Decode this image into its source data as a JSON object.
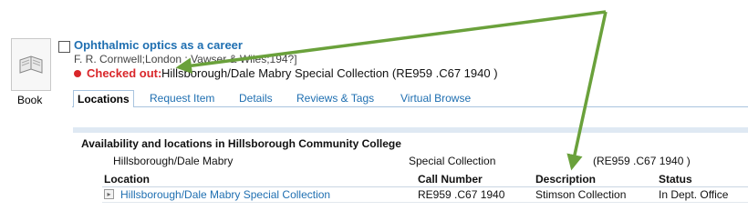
{
  "record": {
    "type_label": "Book",
    "title": "Ophthalmic optics as a career",
    "author_line": "F. R. Cornwell;London : Vawser & Wiles;194?]",
    "status_label": "Checked out:",
    "status_text": "Hillsborough/Dale Mabry Special Collection (RE959 .C67 1940 )"
  },
  "tabs": [
    {
      "label": "Locations",
      "active": true
    },
    {
      "label": "Request Item"
    },
    {
      "label": "Details"
    },
    {
      "label": "Reviews & Tags"
    },
    {
      "label": "Virtual Browse"
    }
  ],
  "availability": {
    "heading": "Availability and locations in Hillsborough Community College",
    "summary": {
      "location": "Hillsborough/Dale Mabry",
      "collection": "Special Collection",
      "call_number": "(RE959 .C67 1940 )"
    },
    "columns": [
      "Location",
      "Call Number",
      "Description",
      "Status"
    ],
    "rows": [
      {
        "location": "Hillsborough/Dale Mabry Special Collection",
        "call_number": "RE959 .C67 1940",
        "description": "Stimson Collection",
        "status": "In Dept. Office"
      }
    ]
  },
  "colors": {
    "link": "#1f6fb1",
    "checked_out": "#d9262a",
    "annotation_arrow": "#6aa13b"
  },
  "icons": {
    "thumbnail": "book-icon",
    "expand": "expand-triangle-icon"
  }
}
